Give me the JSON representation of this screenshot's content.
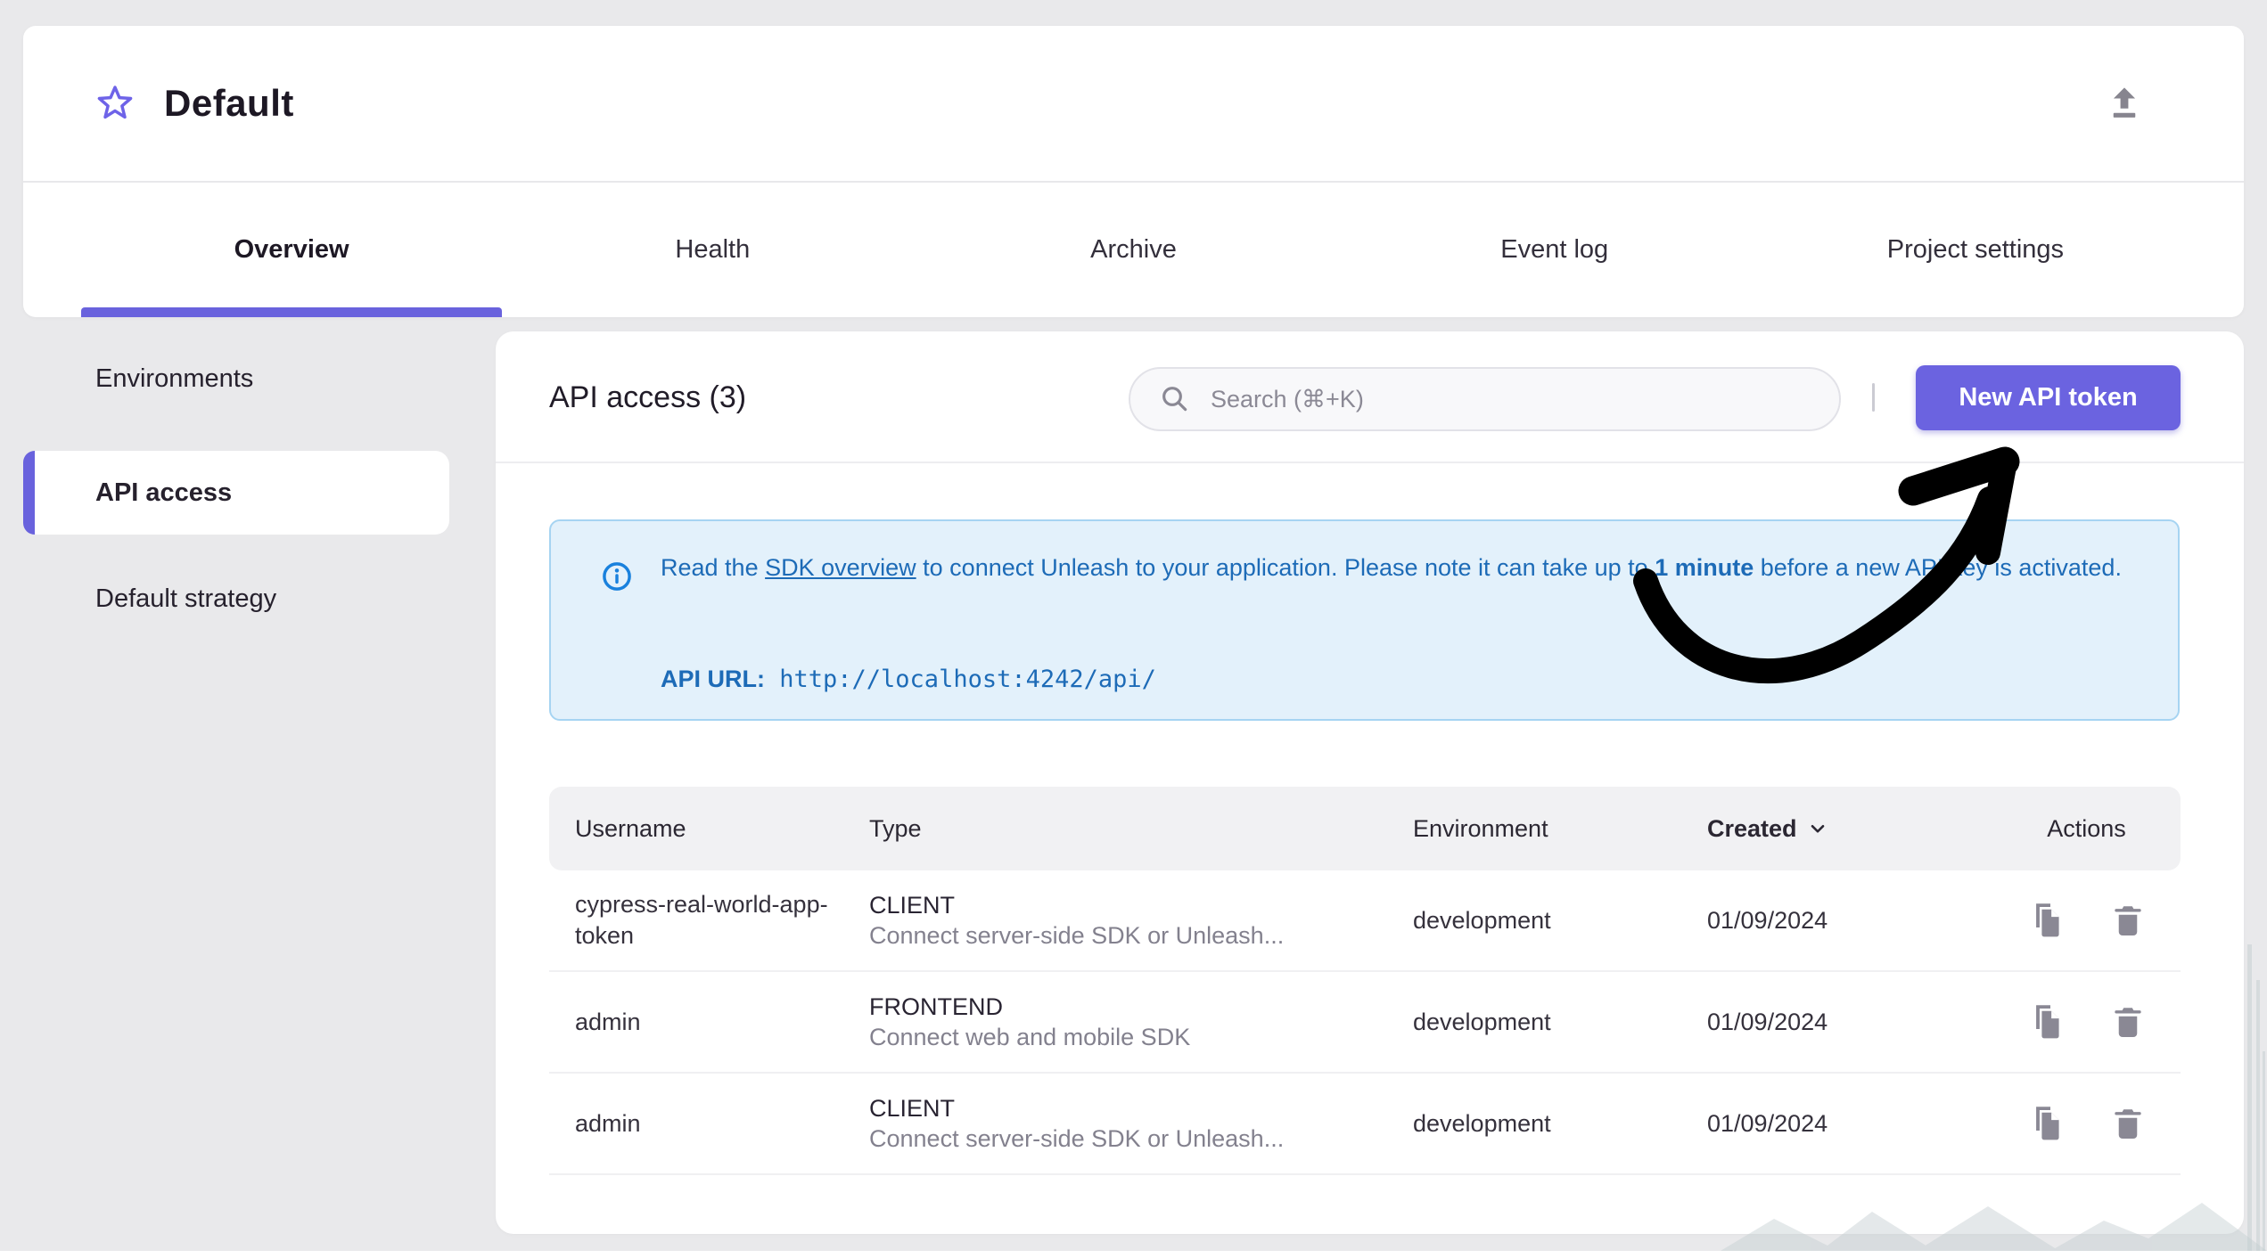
{
  "header": {
    "project_name": "Default"
  },
  "tabs": [
    {
      "label": "Overview",
      "active": true
    },
    {
      "label": "Health",
      "active": false
    },
    {
      "label": "Archive",
      "active": false
    },
    {
      "label": "Event log",
      "active": false
    },
    {
      "label": "Project settings",
      "active": false
    }
  ],
  "sidebar": {
    "items": [
      {
        "label": "Environments",
        "active": false
      },
      {
        "label": "API access",
        "active": true
      },
      {
        "label": "Default strategy",
        "active": false
      }
    ]
  },
  "main": {
    "title": "API access (3)",
    "search": {
      "placeholder": "Search (⌘+K)"
    },
    "new_token_button": "New API token",
    "alert": {
      "text_before_link": "Read the ",
      "link": "SDK overview",
      "text_middle": " to connect Unleash to your application. Please note it can take up to ",
      "bold": "1 minute",
      "text_end": " before a new API key is activated.",
      "api_url_label": "API URL:",
      "api_url_value": " http://localhost:4242/api/"
    },
    "table": {
      "columns": [
        "Username",
        "Type",
        "Environment",
        "Created",
        "Actions"
      ],
      "sorted_by": "Created",
      "sort_direction": "desc",
      "rows": [
        {
          "username": "cypress-real-world-app-token",
          "type": "CLIENT",
          "type_description": "Connect server-side SDK or Unleash...",
          "environment": "development",
          "created": "01/09/2024"
        },
        {
          "username": "admin",
          "type": "FRONTEND",
          "type_description": "Connect web and mobile SDK",
          "environment": "development",
          "created": "01/09/2024"
        },
        {
          "username": "admin",
          "type": "CLIENT",
          "type_description": "Connect server-side SDK or Unleash...",
          "environment": "development",
          "created": "01/09/2024"
        }
      ]
    }
  },
  "icons": {
    "favorite": "star-outline-icon",
    "export": "upload-icon",
    "search": "magnifier-icon",
    "info": "info-circle-icon",
    "sort": "chevron-down-icon",
    "copy": "copy-icon",
    "delete": "trash-icon"
  },
  "colors": {
    "accent": "#6b63e0",
    "page_background": "#e9e9eb",
    "alert_background": "#e3f1fb",
    "alert_border": "#a6d4f2",
    "alert_text": "#1d6bb7",
    "alert_icon": "#1981dd",
    "icon_gray": "#8a8894"
  }
}
